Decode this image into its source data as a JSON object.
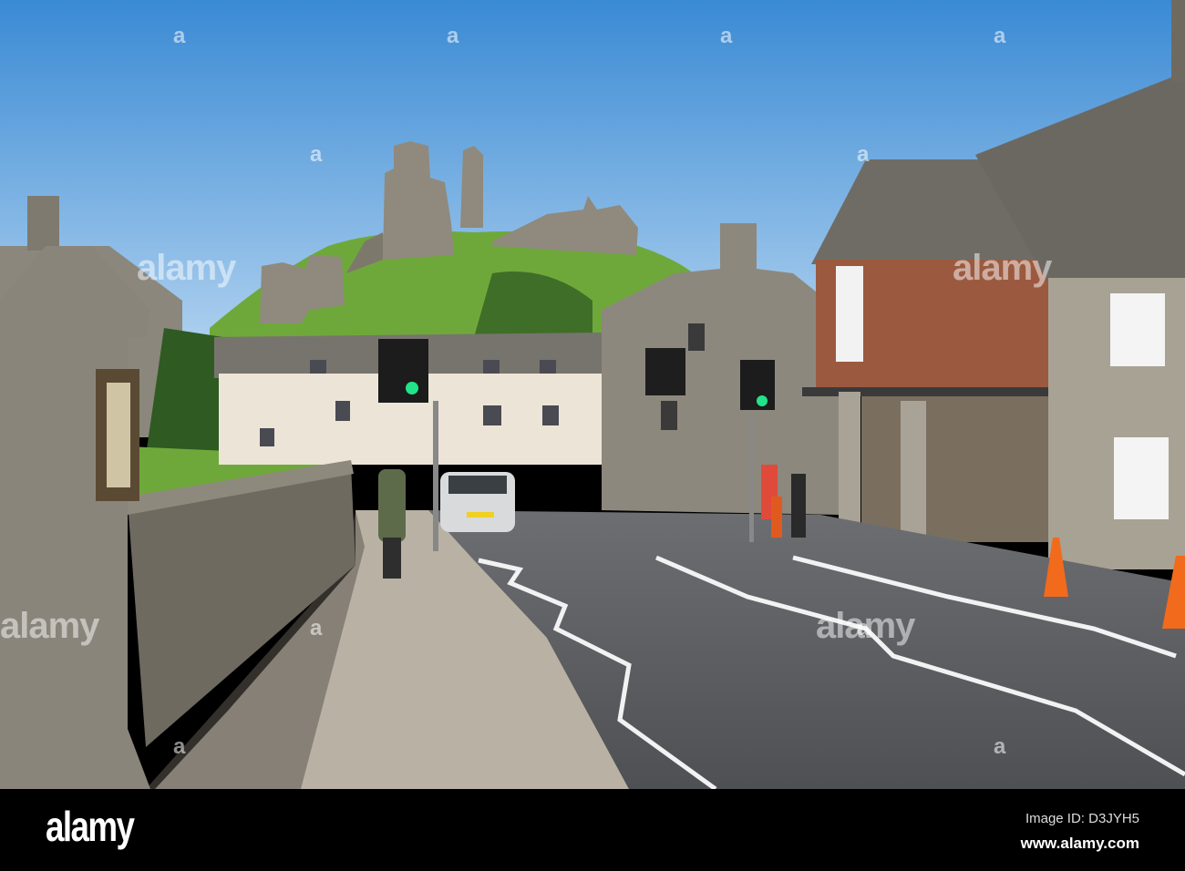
{
  "photo": {
    "subject": "Corfe Castle village street",
    "colors": {
      "sky_top": "#3f8fd6",
      "sky_bottom": "#a9cdee",
      "grass": "#6fa83a",
      "stone": "#8a857a",
      "road": "#5e6064",
      "pavement": "#b9b2a4",
      "brick": "#9b5a40"
    }
  },
  "watermark": {
    "mark": "a",
    "wordmark": "alamy"
  },
  "footer": {
    "logo": "alamy",
    "image_id": "Image ID: D3JYH5",
    "site": "www.alamy.com"
  }
}
